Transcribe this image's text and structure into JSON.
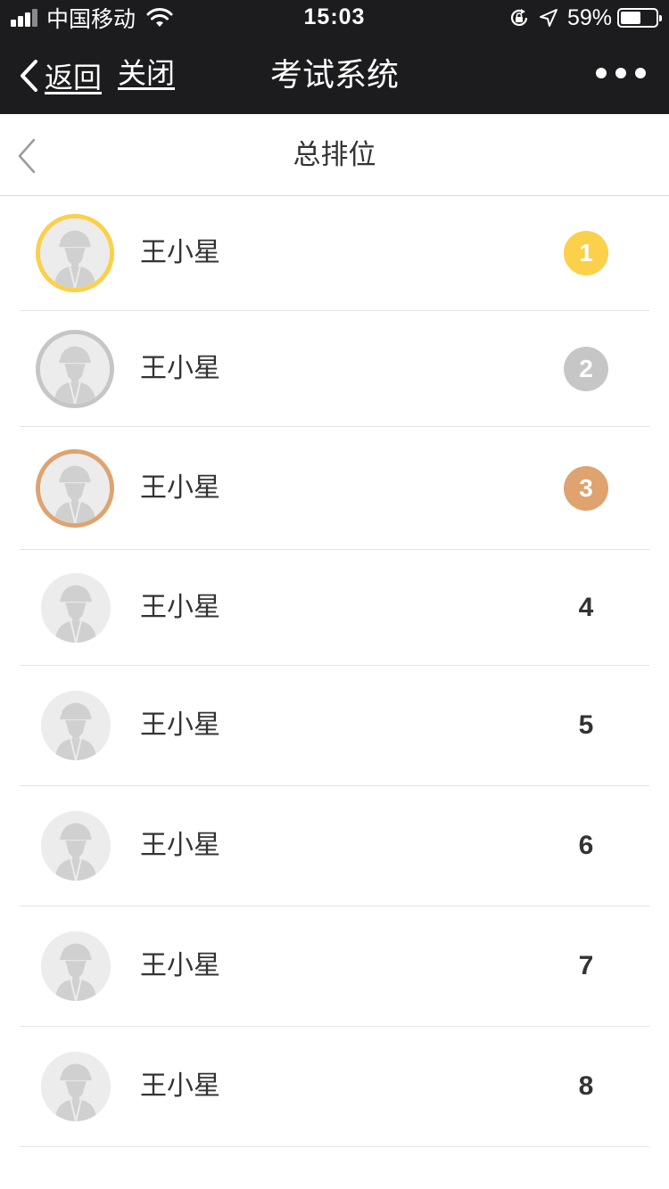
{
  "status_bar": {
    "carrier": "中国移动",
    "time": "15:03",
    "battery_percent": "59%",
    "battery_level": 0.59
  },
  "nav": {
    "back_label": "返回",
    "close_label": "关闭",
    "title": "考试系统",
    "more_icon": "more-dots-icon"
  },
  "page": {
    "title": "总排位"
  },
  "colors": {
    "gold": "#fbd04a",
    "silver": "#c6c6c6",
    "bronze": "#dfa370",
    "dark_bar": "#1c1c1e"
  },
  "ranking": [
    {
      "name": "王小星",
      "rank": "1",
      "medal": "gold"
    },
    {
      "name": "王小星",
      "rank": "2",
      "medal": "silver"
    },
    {
      "name": "王小星",
      "rank": "3",
      "medal": "bronze"
    },
    {
      "name": "王小星",
      "rank": "4",
      "medal": "none"
    },
    {
      "name": "王小星",
      "rank": "5",
      "medal": "none"
    },
    {
      "name": "王小星",
      "rank": "6",
      "medal": "none"
    },
    {
      "name": "王小星",
      "rank": "7",
      "medal": "none"
    },
    {
      "name": "王小星",
      "rank": "8",
      "medal": "none"
    }
  ]
}
